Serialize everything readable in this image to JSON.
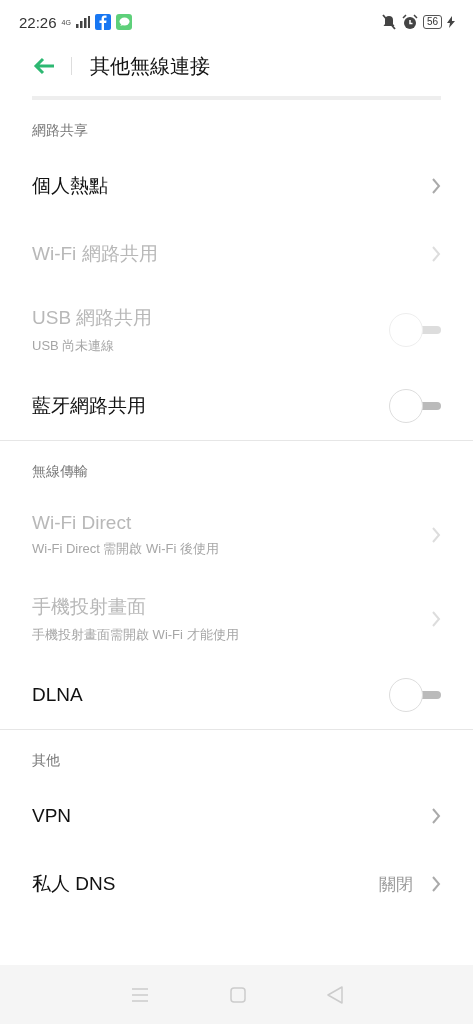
{
  "status_bar": {
    "time": "22:26",
    "network": "4G",
    "battery": "56",
    "charging": true
  },
  "header": {
    "title": "其他無線連接"
  },
  "sections": [
    {
      "title": "網路共享",
      "items": [
        {
          "kind": "link",
          "label": "個人熱點",
          "disabled": false
        },
        {
          "kind": "link",
          "label": "Wi-Fi 網路共用",
          "disabled": true
        },
        {
          "kind": "toggle",
          "label": "USB 網路共用",
          "subtitle": "USB 尚未連線",
          "disabled": true,
          "on": false
        },
        {
          "kind": "toggle",
          "label": "藍牙網路共用",
          "disabled": false,
          "on": false
        }
      ]
    },
    {
      "title": "無線傳輸",
      "items": [
        {
          "kind": "link",
          "label": "Wi-Fi Direct",
          "subtitle": "Wi-Fi Direct 需開啟 Wi-Fi 後使用",
          "disabled": true
        },
        {
          "kind": "link",
          "label": "手機投射畫面",
          "subtitle": "手機投射畫面需開啟 Wi-Fi 才能使用",
          "disabled": true
        },
        {
          "kind": "toggle",
          "label": "DLNA",
          "disabled": false,
          "on": false
        }
      ]
    },
    {
      "title": "其他",
      "items": [
        {
          "kind": "link",
          "label": "VPN",
          "disabled": false
        },
        {
          "kind": "link",
          "label": "私人 DNS",
          "value": "關閉",
          "disabled": false
        }
      ]
    }
  ]
}
